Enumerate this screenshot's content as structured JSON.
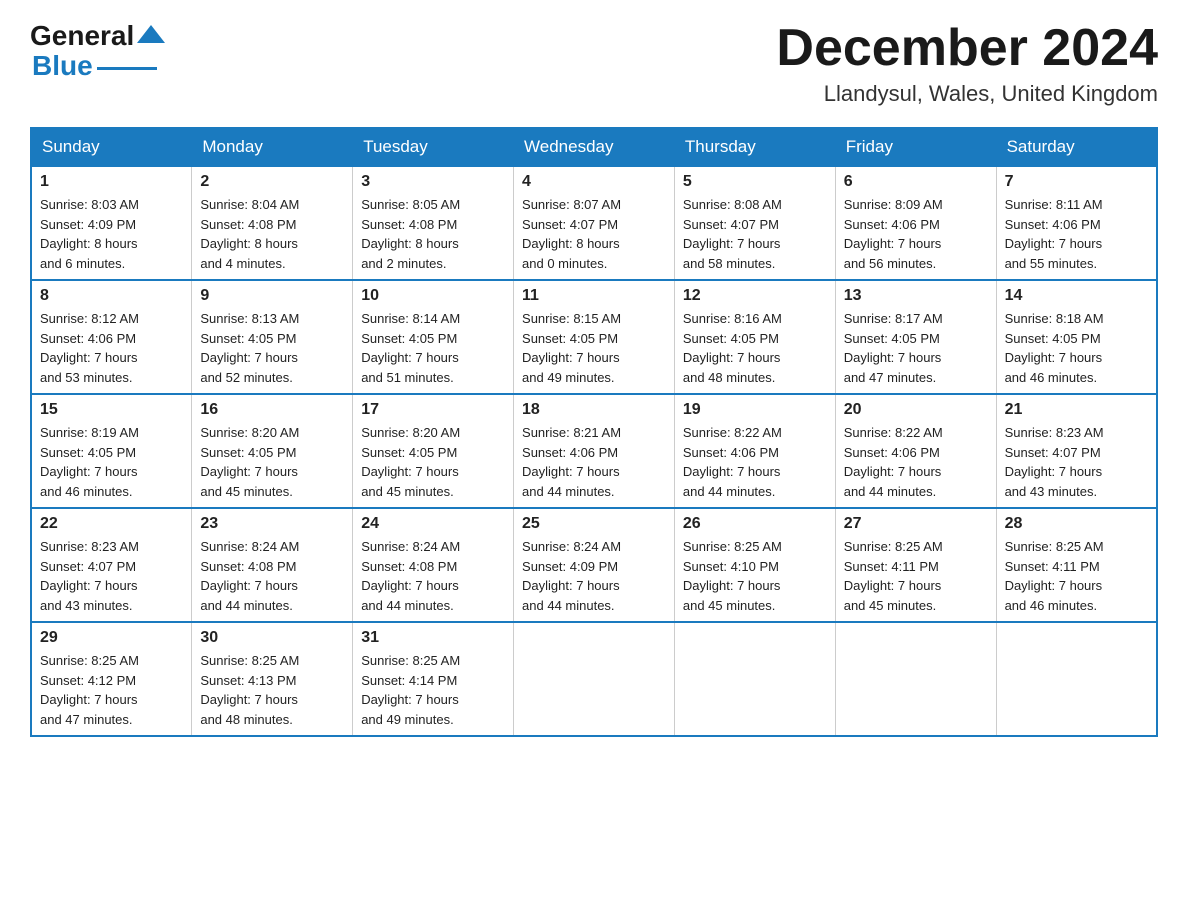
{
  "header": {
    "logo_general": "General",
    "logo_blue": "Blue",
    "main_title": "December 2024",
    "subtitle": "Llandysul, Wales, United Kingdom"
  },
  "calendar": {
    "days_of_week": [
      "Sunday",
      "Monday",
      "Tuesday",
      "Wednesday",
      "Thursday",
      "Friday",
      "Saturday"
    ],
    "weeks": [
      [
        {
          "day": "1",
          "info": "Sunrise: 8:03 AM\nSunset: 4:09 PM\nDaylight: 8 hours\nand 6 minutes."
        },
        {
          "day": "2",
          "info": "Sunrise: 8:04 AM\nSunset: 4:08 PM\nDaylight: 8 hours\nand 4 minutes."
        },
        {
          "day": "3",
          "info": "Sunrise: 8:05 AM\nSunset: 4:08 PM\nDaylight: 8 hours\nand 2 minutes."
        },
        {
          "day": "4",
          "info": "Sunrise: 8:07 AM\nSunset: 4:07 PM\nDaylight: 8 hours\nand 0 minutes."
        },
        {
          "day": "5",
          "info": "Sunrise: 8:08 AM\nSunset: 4:07 PM\nDaylight: 7 hours\nand 58 minutes."
        },
        {
          "day": "6",
          "info": "Sunrise: 8:09 AM\nSunset: 4:06 PM\nDaylight: 7 hours\nand 56 minutes."
        },
        {
          "day": "7",
          "info": "Sunrise: 8:11 AM\nSunset: 4:06 PM\nDaylight: 7 hours\nand 55 minutes."
        }
      ],
      [
        {
          "day": "8",
          "info": "Sunrise: 8:12 AM\nSunset: 4:06 PM\nDaylight: 7 hours\nand 53 minutes."
        },
        {
          "day": "9",
          "info": "Sunrise: 8:13 AM\nSunset: 4:05 PM\nDaylight: 7 hours\nand 52 minutes."
        },
        {
          "day": "10",
          "info": "Sunrise: 8:14 AM\nSunset: 4:05 PM\nDaylight: 7 hours\nand 51 minutes."
        },
        {
          "day": "11",
          "info": "Sunrise: 8:15 AM\nSunset: 4:05 PM\nDaylight: 7 hours\nand 49 minutes."
        },
        {
          "day": "12",
          "info": "Sunrise: 8:16 AM\nSunset: 4:05 PM\nDaylight: 7 hours\nand 48 minutes."
        },
        {
          "day": "13",
          "info": "Sunrise: 8:17 AM\nSunset: 4:05 PM\nDaylight: 7 hours\nand 47 minutes."
        },
        {
          "day": "14",
          "info": "Sunrise: 8:18 AM\nSunset: 4:05 PM\nDaylight: 7 hours\nand 46 minutes."
        }
      ],
      [
        {
          "day": "15",
          "info": "Sunrise: 8:19 AM\nSunset: 4:05 PM\nDaylight: 7 hours\nand 46 minutes."
        },
        {
          "day": "16",
          "info": "Sunrise: 8:20 AM\nSunset: 4:05 PM\nDaylight: 7 hours\nand 45 minutes."
        },
        {
          "day": "17",
          "info": "Sunrise: 8:20 AM\nSunset: 4:05 PM\nDaylight: 7 hours\nand 45 minutes."
        },
        {
          "day": "18",
          "info": "Sunrise: 8:21 AM\nSunset: 4:06 PM\nDaylight: 7 hours\nand 44 minutes."
        },
        {
          "day": "19",
          "info": "Sunrise: 8:22 AM\nSunset: 4:06 PM\nDaylight: 7 hours\nand 44 minutes."
        },
        {
          "day": "20",
          "info": "Sunrise: 8:22 AM\nSunset: 4:06 PM\nDaylight: 7 hours\nand 44 minutes."
        },
        {
          "day": "21",
          "info": "Sunrise: 8:23 AM\nSunset: 4:07 PM\nDaylight: 7 hours\nand 43 minutes."
        }
      ],
      [
        {
          "day": "22",
          "info": "Sunrise: 8:23 AM\nSunset: 4:07 PM\nDaylight: 7 hours\nand 43 minutes."
        },
        {
          "day": "23",
          "info": "Sunrise: 8:24 AM\nSunset: 4:08 PM\nDaylight: 7 hours\nand 44 minutes."
        },
        {
          "day": "24",
          "info": "Sunrise: 8:24 AM\nSunset: 4:08 PM\nDaylight: 7 hours\nand 44 minutes."
        },
        {
          "day": "25",
          "info": "Sunrise: 8:24 AM\nSunset: 4:09 PM\nDaylight: 7 hours\nand 44 minutes."
        },
        {
          "day": "26",
          "info": "Sunrise: 8:25 AM\nSunset: 4:10 PM\nDaylight: 7 hours\nand 45 minutes."
        },
        {
          "day": "27",
          "info": "Sunrise: 8:25 AM\nSunset: 4:11 PM\nDaylight: 7 hours\nand 45 minutes."
        },
        {
          "day": "28",
          "info": "Sunrise: 8:25 AM\nSunset: 4:11 PM\nDaylight: 7 hours\nand 46 minutes."
        }
      ],
      [
        {
          "day": "29",
          "info": "Sunrise: 8:25 AM\nSunset: 4:12 PM\nDaylight: 7 hours\nand 47 minutes."
        },
        {
          "day": "30",
          "info": "Sunrise: 8:25 AM\nSunset: 4:13 PM\nDaylight: 7 hours\nand 48 minutes."
        },
        {
          "day": "31",
          "info": "Sunrise: 8:25 AM\nSunset: 4:14 PM\nDaylight: 7 hours\nand 49 minutes."
        },
        {
          "day": "",
          "info": ""
        },
        {
          "day": "",
          "info": ""
        },
        {
          "day": "",
          "info": ""
        },
        {
          "day": "",
          "info": ""
        }
      ]
    ]
  }
}
